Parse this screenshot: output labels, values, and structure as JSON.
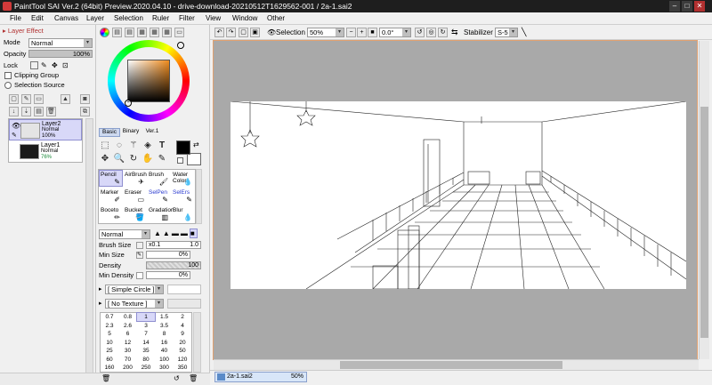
{
  "window": {
    "title": "PaintTool SAI Ver.2 (64bit) Preview.2020.04.10 - drive-download-20210512T1629562-001 / 2a-1.sai2",
    "minimize": "–",
    "maximize": "□",
    "close": "✕"
  },
  "menu": [
    "File",
    "Edit",
    "Canvas",
    "Layer",
    "Selection",
    "Ruler",
    "Filter",
    "View",
    "Window",
    "Other"
  ],
  "layer_panel": {
    "header": "Layer Effect",
    "mode_label": "Mode",
    "mode_value": "Normal",
    "opacity_label": "Opacity",
    "opacity_value": "100%",
    "opacity_fraction": 1.0,
    "lock_label": "Lock",
    "clipping_group": "Clipping Group",
    "selection_source": "Selection Source",
    "layers": [
      {
        "name": "Layer2",
        "mode": "Normal",
        "opacity": "100%",
        "selected": true
      },
      {
        "name": "Layer1",
        "mode": "Normal",
        "opacity": "76%",
        "selected": false
      }
    ]
  },
  "color_panel": {
    "tabs": [
      "Basic",
      "Binary",
      "Ver.1"
    ],
    "fg_color": "#000000",
    "bg_color": "#ffffff",
    "hue_color": "#f08c1e"
  },
  "tools": {
    "brush_grid": [
      {
        "label": "Pencil",
        "selected": true
      },
      {
        "label": "AirBrush",
        "selected": false
      },
      {
        "label": "Brush",
        "selected": false
      },
      {
        "label": "Water Color",
        "selected": false
      },
      {
        "label": "Marker",
        "selected": false
      },
      {
        "label": "Eraser",
        "selected": false
      },
      {
        "label": "SelPen",
        "selected": false
      },
      {
        "label": "SelErs",
        "selected": false
      },
      {
        "label": "Boceto",
        "selected": false
      },
      {
        "label": "Bucket",
        "selected": false
      },
      {
        "label": "Gradation",
        "selected": false
      },
      {
        "label": "Blur",
        "selected": false
      }
    ],
    "blend_mode": "Normal",
    "brush_size_label": "Brush Size",
    "brush_size_mult": "x0.1",
    "brush_size_value": "1.0",
    "min_size_label": "Min Size",
    "min_size_value": "0%",
    "density_label": "Density",
    "density_value": "100",
    "min_density_label": "Min Density",
    "min_density_value": "0%",
    "shape": "[ Simple Circle ]",
    "texture": "[ No Texture ]",
    "size_presets": [
      "0.7",
      "0.8",
      "1",
      "1.5",
      "2",
      "2.3",
      "2.6",
      "3",
      "3.5",
      "4",
      "5",
      "6",
      "7",
      "8",
      "9",
      "10",
      "12",
      "14",
      "16",
      "20",
      "25",
      "30",
      "35",
      "40",
      "50",
      "60",
      "70",
      "80",
      "100",
      "120",
      "160",
      "200",
      "250",
      "300",
      "350"
    ],
    "selected_size": "1"
  },
  "canvas_toolbar": {
    "selection_label": "Selection",
    "zoom": "50%",
    "angle": "0.0°",
    "stabilizer_label": "Stabilizer",
    "stabilizer_value": "S-5"
  },
  "document_tab": {
    "name": "2a-1.sai2",
    "zoom": "50%"
  },
  "colors": {
    "accent_border": "#e0a070",
    "layer_selected": "#d8d8f8",
    "canvas_bg": "#a9a9a9"
  }
}
